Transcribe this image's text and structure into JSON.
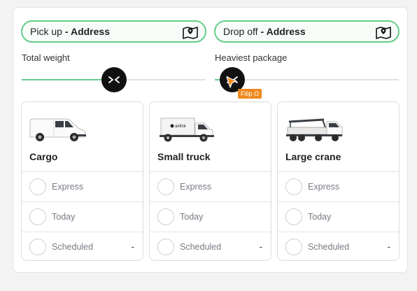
{
  "pickup": {
    "label": "Pick up",
    "separator": "-",
    "value": "Address",
    "icon": "map-pin-icon"
  },
  "dropoff": {
    "label": "Drop off",
    "separator": "-",
    "value": "Address",
    "icon": "map-pin-icon"
  },
  "sliders": {
    "total_weight": {
      "label": "Total weight",
      "fill_fraction": 0.5
    },
    "heaviest_package": {
      "label": "Heaviest package",
      "fill_fraction": 0.05
    }
  },
  "cursor_tooltip": "Filip O",
  "vehicles": [
    {
      "name": "Cargo",
      "image": "van-icon",
      "options": [
        {
          "label": "Express",
          "price": ""
        },
        {
          "label": "Today",
          "price": ""
        },
        {
          "label": "Scheduled",
          "price": "-"
        }
      ]
    },
    {
      "name": "Small truck",
      "image": "small-truck-icon",
      "brand": "airlink",
      "options": [
        {
          "label": "Express",
          "price": ""
        },
        {
          "label": "Today",
          "price": ""
        },
        {
          "label": "Scheduled",
          "price": "-"
        }
      ]
    },
    {
      "name": "Large crane",
      "image": "crane-truck-icon",
      "options": [
        {
          "label": "Express",
          "price": ""
        },
        {
          "label": "Today",
          "price": ""
        },
        {
          "label": "Scheduled",
          "price": "-"
        }
      ]
    }
  ],
  "colors": {
    "accent": "#65cc8a",
    "knob": "#111111",
    "tooltip": "#f0891e"
  }
}
